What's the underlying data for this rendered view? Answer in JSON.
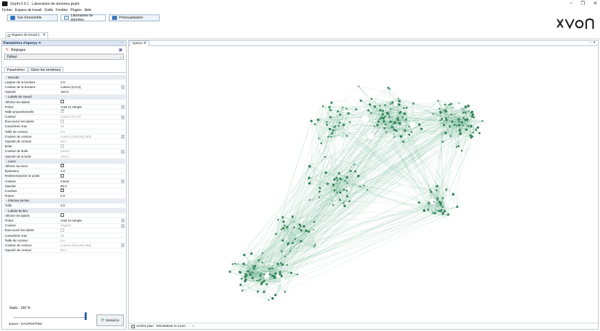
{
  "window": {
    "title": "Gephi 0.9.1 - Laboratoire de données.gephi",
    "minimize": "–",
    "maximize": "❐",
    "close": "✕"
  },
  "menu": [
    "Fichier",
    "Espace de travail",
    "Outils",
    "Fenêtre",
    "Plugins",
    "Aide"
  ],
  "workspaces": {
    "overview": "Vue d'ensemble",
    "data_lab": "Laboratoire de données",
    "preview": "Prévisualisation"
  },
  "workspace_tab": {
    "label": "Espace de travail 1",
    "close": "✕"
  },
  "settings_panel": {
    "title": "Paramètres d'aperçu ✕",
    "minimize": "–",
    "presets_label": "Réglages",
    "preset_value": "Défaut",
    "tabs": [
      "Paramètres",
      "Gérer les renderers"
    ],
    "ratio_label": "Ratio : 100 %",
    "refresh": "Rafraîchir",
    "export": "Export :  SVG/PDF/PNG"
  },
  "properties": [
    {
      "type": "cat",
      "label": "- Noeuds"
    },
    {
      "label": "Largeur de la bordure",
      "value": "2.0"
    },
    {
      "label": "Couleur de la bordure",
      "value": "custom [0,0,0]",
      "edit": true
    },
    {
      "label": "Opacité",
      "value": "100.0"
    },
    {
      "type": "cat",
      "label": "- Labels de noeud"
    },
    {
      "label": "Afficher les labels",
      "check": false
    },
    {
      "label": "Police",
      "value": "Arial 12 Simple",
      "edit": true
    },
    {
      "label": "Taille proportionnelle",
      "check": true,
      "disabled": true
    },
    {
      "label": "Couleur",
      "value": "custom [0,0,0]",
      "edit": true,
      "disabled": true
    },
    {
      "label": "Raccourcir les labels",
      "check": false,
      "disabled": true
    },
    {
      "label": "Caractères max",
      "value": "30",
      "disabled": true
    },
    {
      "label": "Taille de contour",
      "value": "0.0",
      "disabled": true
    },
    {
      "label": "Couleur de contour",
      "value": "custom [255,255,255]",
      "edit": true,
      "disabled": true
    },
    {
      "label": "Opacité de contour",
      "value": "80.0",
      "disabled": true
    },
    {
      "label": "Boite",
      "check": false,
      "disabled": true
    },
    {
      "label": "Couleur de boite",
      "value": "parent",
      "edit": true,
      "disabled": true
    },
    {
      "label": "Opacité de la boite",
      "value": "100.0",
      "disabled": true
    },
    {
      "type": "cat",
      "label": "- Liens"
    },
    {
      "label": "Afficher les liens",
      "check": true
    },
    {
      "label": "Épaisseur",
      "value": "1.0"
    },
    {
      "label": "Redimensionner le poids",
      "check": false
    },
    {
      "label": "Couleur",
      "value": "mixed",
      "edit": true
    },
    {
      "label": "Opacité",
      "value": "80.0"
    },
    {
      "label": "Courbes",
      "check": true
    },
    {
      "label": "Rayon",
      "value": "0.0"
    },
    {
      "type": "cat",
      "label": "- Flèches de lien"
    },
    {
      "label": "Taille",
      "value": "3.0"
    },
    {
      "type": "cat",
      "label": "- Labels de lien"
    },
    {
      "label": "Afficher les labels",
      "check": false
    },
    {
      "label": "Police",
      "value": "Arial 10 Simple",
      "edit": true
    },
    {
      "label": "Couleur",
      "value": "original",
      "edit": true,
      "disabled": true
    },
    {
      "label": "Raccourcir les labels",
      "check": false,
      "disabled": true
    },
    {
      "label": "Caractères max",
      "value": "30",
      "disabled": true
    },
    {
      "label": "Taille de contour",
      "value": "0.0",
      "disabled": true
    },
    {
      "label": "Couleur de contour",
      "value": "custom [255,255,255]",
      "edit": true,
      "disabled": true
    },
    {
      "label": "Opacité de contour",
      "value": "80.0",
      "disabled": true
    }
  ],
  "preview": {
    "tab_label": "Aperçu ✕",
    "nav": "‹ › ▾",
    "background_label": "Arrière-plan",
    "reset_zoom": "Réinitialiser le zoom",
    "zoom_out": "-",
    "zoom_in": "+"
  },
  "colors": {
    "node": "#2e8b57",
    "edge": "#3a9a6c",
    "accent": "#2a5fb3"
  }
}
